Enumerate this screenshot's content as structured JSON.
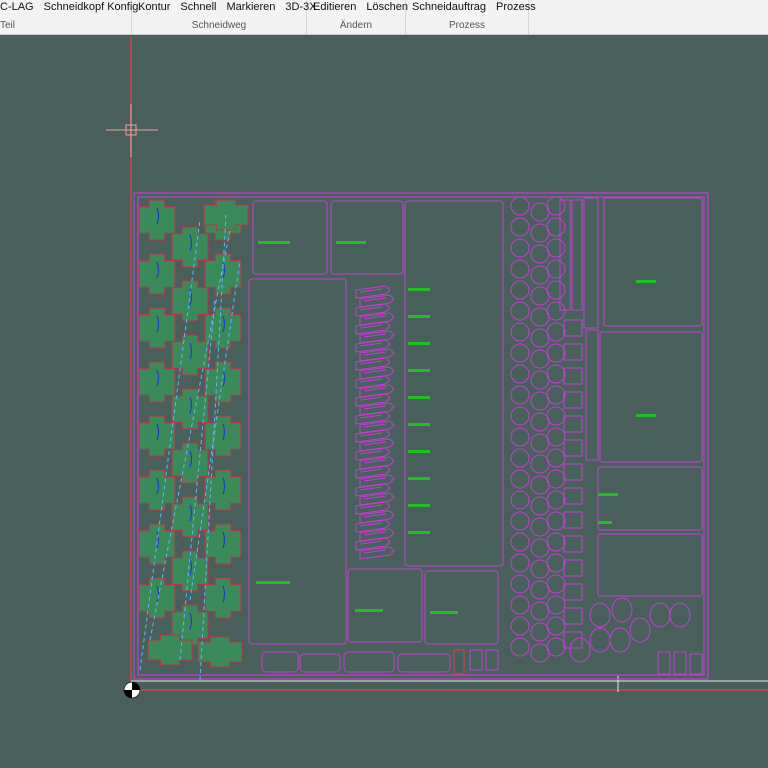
{
  "ribbon": {
    "groups": [
      {
        "caption": "Teil",
        "items": [
          "C-LAG",
          "Schneidkopf Konfig."
        ]
      },
      {
        "caption": "Schneidweg",
        "items": [
          "Kontur",
          "Schnell",
          "Markieren",
          "3D-3X"
        ]
      },
      {
        "caption": "Ändern",
        "items": [
          "Editieren",
          "Löschen"
        ]
      },
      {
        "caption": "Prozess",
        "items": [
          "Schneidauftrag",
          "Prozess"
        ]
      }
    ]
  },
  "colors": {
    "background": "#485f5c",
    "sheet_outline": "#c040d0",
    "part_fill": "#3a8a5a",
    "part_outline": "#c0304a",
    "cut_path": "#60b8ff",
    "axis": "#d04050",
    "label": "#20c020"
  }
}
